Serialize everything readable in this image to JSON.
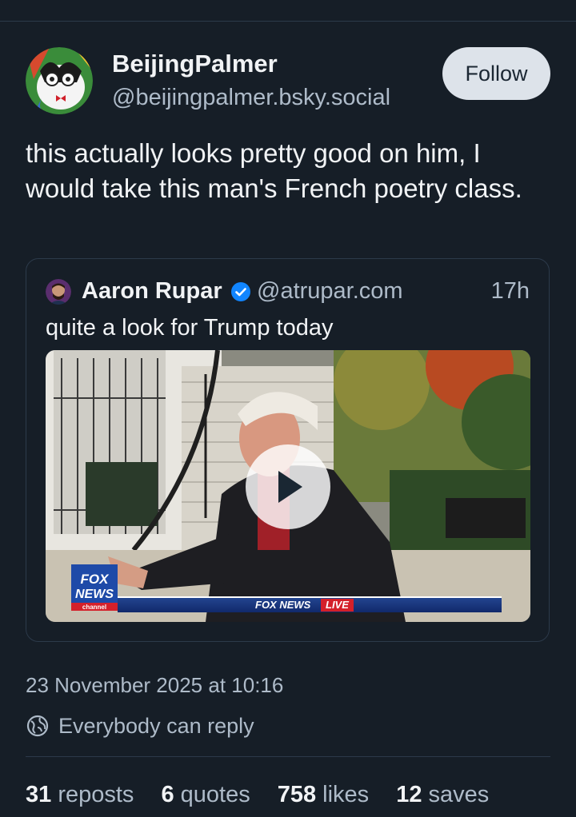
{
  "post": {
    "author_name": "BeijingPalmer",
    "author_handle": "@beijingpalmer.bsky.social",
    "follow_label": "Follow",
    "text": "this actually looks pretty good on him, I would take this man's French poetry class.",
    "date": "23 November 2025 at 10:16",
    "reply_setting": "Everybody can reply"
  },
  "quote": {
    "author_name": "Aaron Rupar",
    "author_handle": "@atrupar.com",
    "time": "17h",
    "text": "quite a look for Trump today",
    "video_overlay": {
      "network_text": "FOX NEWS",
      "live_text": "LIVE"
    }
  },
  "stats": {
    "reposts_count": "31",
    "reposts_label": "reposts",
    "quotes_count": "6",
    "quotes_label": "quotes",
    "likes_count": "758",
    "likes_label": "likes",
    "saves_count": "12",
    "saves_label": "saves"
  },
  "colors": {
    "background": "#161e27",
    "verified_badge": "#1185fe",
    "fox_red": "#d4202a"
  },
  "icons": {
    "verified": "verified-check-icon",
    "reply": "globe-icon",
    "play": "play-icon"
  }
}
